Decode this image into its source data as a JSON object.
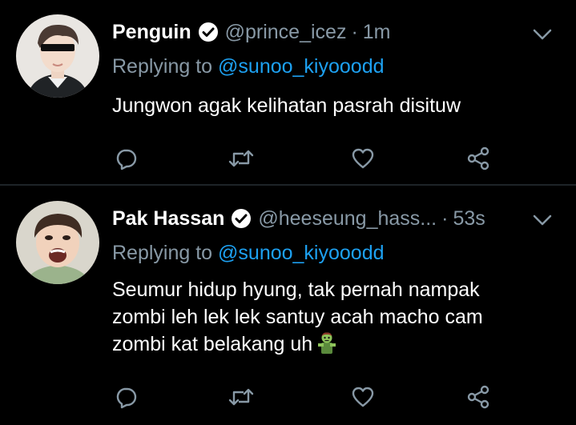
{
  "colors": {
    "background": "#000000",
    "text": "#ffffff",
    "secondary": "#8899a6",
    "link": "#1da1f2",
    "divider": "#1e2428"
  },
  "tweets": [
    {
      "name": "Penguin",
      "verified": true,
      "handle": "@prince_icez",
      "separator": "·",
      "time": "1m",
      "replying_prefix": "Replying to ",
      "replying_to": "@sunoo_kiyooodd",
      "body_lines": [
        "Jungwon agak kelihatan pasrah disituw"
      ],
      "icons": [
        "reply-icon",
        "retweet-icon",
        "like-icon",
        "share-icon",
        "chevron-down-icon"
      ]
    },
    {
      "name": "Pak Hassan",
      "verified": true,
      "handle": "@heeseung_hass...",
      "separator": "·",
      "time": "53s",
      "replying_prefix": "Replying to ",
      "replying_to": "@sunoo_kiyooodd",
      "body_lines": [
        "Seumur hidup hyung, tak pernah nampak",
        "zombi leh lek lek santuy acah macho cam",
        "zombi kat belakang uh"
      ],
      "emoji": "zombie-emoji",
      "icons": [
        "reply-icon",
        "retweet-icon",
        "like-icon",
        "share-icon",
        "chevron-down-icon"
      ]
    }
  ]
}
